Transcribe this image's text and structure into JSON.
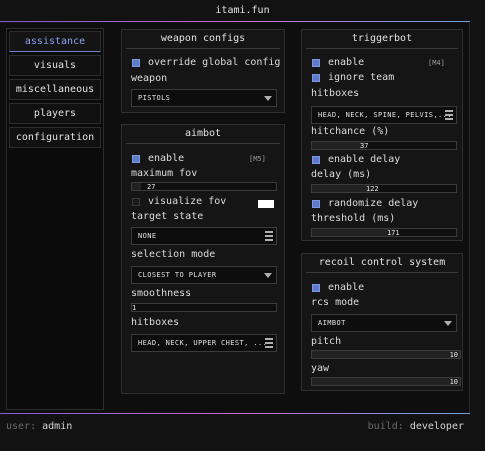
{
  "app": {
    "title": "itami.fun"
  },
  "sidebar": {
    "items": [
      {
        "label": "assistance",
        "active": true
      },
      {
        "label": "visuals"
      },
      {
        "label": "miscellaneous"
      },
      {
        "label": "players"
      },
      {
        "label": "configuration"
      }
    ]
  },
  "weapon_configs": {
    "title": "weapon configs",
    "override_label": "override global config",
    "override_checked": true,
    "weapon_label": "weapon",
    "weapon_value": "PISTOLS"
  },
  "aimbot": {
    "title": "aimbot",
    "enable_label": "enable",
    "enable_checked": true,
    "enable_key": "[M5]",
    "max_fov_label": "maximum fov",
    "max_fov_value": "27",
    "max_fov_fraction": 0.06,
    "visualize_fov_label": "visualize fov",
    "visualize_fov_checked": false,
    "fov_color": "#ffffff",
    "target_state_label": "target state",
    "target_state_value": "NONE",
    "selection_mode_label": "selection mode",
    "selection_mode_value": "CLOSEST TO PLAYER",
    "smoothness_label": "smoothness",
    "smoothness_value": "1",
    "smoothness_fraction": 0.0,
    "hitboxes_label": "hitboxes",
    "hitboxes_value": "HEAD, NECK, UPPER CHEST, ..."
  },
  "triggerbot": {
    "title": "triggerbot",
    "enable_label": "enable",
    "enable_checked": true,
    "enable_key": "[M4]",
    "ignore_team_label": "ignore team",
    "ignore_team_checked": true,
    "hitboxes_label": "hitboxes",
    "hitboxes_value": "HEAD, NECK, SPINE, PELVIS,...",
    "hitchance_label": "hitchance (%)",
    "hitchance_value": "37",
    "hitchance_fraction": 0.37,
    "enable_delay_label": "enable delay",
    "enable_delay_checked": true,
    "delay_label": "delay (ms)",
    "delay_value": "122",
    "delay_fraction": 0.41,
    "randomize_delay_label": "randomize delay",
    "randomize_delay_checked": true,
    "threshold_label": "threshold (ms)",
    "threshold_value": "171",
    "threshold_fraction": 0.57
  },
  "rcs": {
    "title": "recoil control system",
    "enable_label": "enable",
    "enable_checked": true,
    "mode_label": "rcs mode",
    "mode_value": "AIMBOT",
    "pitch_label": "pitch",
    "pitch_value": "10",
    "pitch_fraction": 1.0,
    "yaw_label": "yaw",
    "yaw_value": "10",
    "yaw_fraction": 1.0
  },
  "footer": {
    "user_prefix": "user:",
    "user_value": "admin",
    "build_prefix": "build:",
    "build_value": "developer"
  },
  "colors": {
    "accent": "#5f7ccc",
    "active_tab": "#8aa2f0",
    "background": "#121212"
  }
}
